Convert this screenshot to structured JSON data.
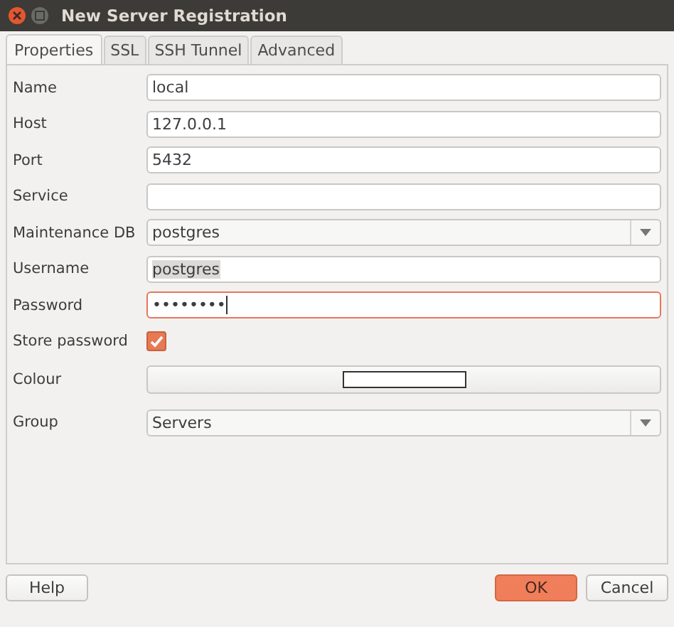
{
  "window": {
    "title": "New Server Registration"
  },
  "tabs": [
    {
      "label": "Properties",
      "selected": true
    },
    {
      "label": "SSL",
      "selected": false
    },
    {
      "label": "SSH Tunnel",
      "selected": false
    },
    {
      "label": "Advanced",
      "selected": false
    }
  ],
  "fields": [
    {
      "label": "Name",
      "kind": "text",
      "value": "local",
      "focused": false
    },
    {
      "label": "Host",
      "kind": "text",
      "value": "127.0.0.1",
      "focused": false
    },
    {
      "label": "Port",
      "kind": "text",
      "value": "5432",
      "focused": false
    },
    {
      "label": "Service",
      "kind": "text",
      "focused": false
    },
    {
      "label": "Maintenance DB",
      "kind": "select",
      "value": "postgres"
    },
    {
      "label": "Username",
      "kind": "text",
      "value": "postgres",
      "focused": false,
      "highlighted": true
    },
    {
      "label": "Password",
      "kind": "text",
      "value": "••••••••",
      "focused": true
    },
    {
      "label": "Store password",
      "kind": "checkbox",
      "checked": true
    },
    {
      "label": "Colour",
      "kind": "colour"
    },
    {
      "label": "Group",
      "kind": "select",
      "value": "Servers"
    }
  ],
  "buttons": [
    {
      "label": "Help",
      "kind": "plain"
    },
    {
      "label": "OK",
      "kind": "primary"
    },
    {
      "label": "Cancel",
      "kind": "plain"
    }
  ]
}
